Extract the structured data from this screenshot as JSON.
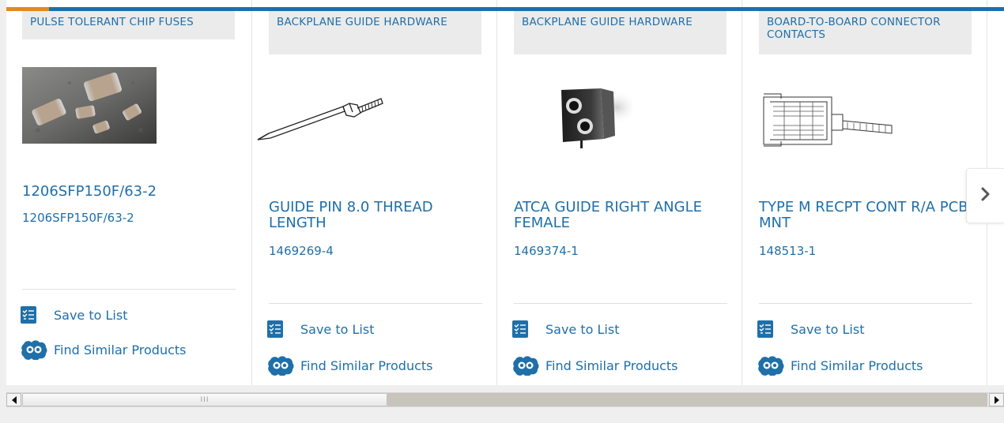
{
  "carousel": {
    "next_icon": "chevron-right-icon",
    "products": [
      {
        "category": "PULSE TOLERANT CHIP FUSES",
        "title": "1206SFP150F/63-2",
        "part_number": "1206SFP150F/63-2",
        "image": "chip-fuses-photo",
        "save_label": "Save to List",
        "similar_label": "Find Similar Products"
      },
      {
        "category": "BACKPLANE GUIDE HARDWARE",
        "title": "GUIDE PIN 8.0 THREAD LENGTH",
        "part_number": "1469269-4",
        "image": "guide-pin-drawing",
        "save_label": "Save to List",
        "similar_label": "Find Similar Products"
      },
      {
        "category": "BACKPLANE GUIDE HARDWARE",
        "title": "ATCA GUIDE RIGHT ANGLE FEMALE",
        "part_number": "1469374-1",
        "image": "right-angle-guide-photo",
        "save_label": "Save to List",
        "similar_label": "Find Similar Products"
      },
      {
        "category": "BOARD-TO-BOARD CONNECTOR CONTACTS",
        "title": "TYPE M RECPT CONT R/A PCB MNT",
        "part_number": "148513-1",
        "image": "connector-contact-drawing",
        "save_label": "Save to List",
        "similar_label": "Find Similar Products"
      }
    ]
  },
  "colors": {
    "accent_blue": "#1f6fa8",
    "accent_orange": "#e08a1e",
    "category_bg": "#ebebeb"
  },
  "scrollbar": {
    "left_icon": "arrow-left-icon",
    "right_icon": "arrow-right-icon",
    "grip_label": "III"
  }
}
